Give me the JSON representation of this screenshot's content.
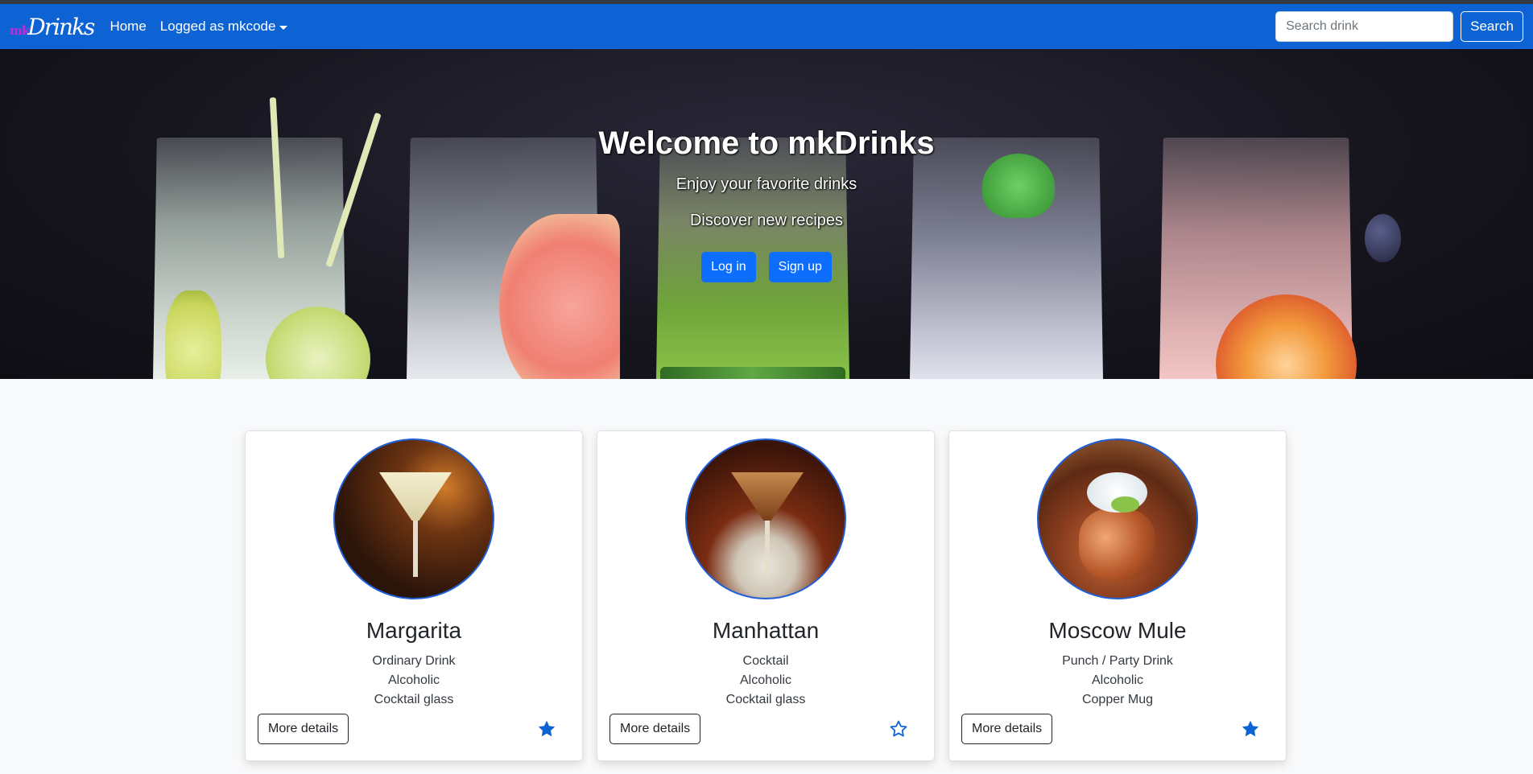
{
  "navbar": {
    "brand_prefix": "mk",
    "brand_suffix": "Drinks",
    "home_label": "Home",
    "user_menu_label": "Logged as mkcode",
    "search_placeholder": "Search drink",
    "search_value": "",
    "search_button_label": "Search"
  },
  "hero": {
    "title": "Welcome to mkDrinks",
    "subtitle_1": "Enjoy your favorite drinks",
    "subtitle_2": "Discover new recipes",
    "login_label": "Log in",
    "signup_label": "Sign up"
  },
  "cards": [
    {
      "name": "Margarita",
      "category": "Ordinary Drink",
      "alcoholic": "Alcoholic",
      "glass": "Cocktail glass",
      "details_label": "More details",
      "favorite": true
    },
    {
      "name": "Manhattan",
      "category": "Cocktail",
      "alcoholic": "Alcoholic",
      "glass": "Cocktail glass",
      "details_label": "More details",
      "favorite": false
    },
    {
      "name": "Moscow Mule",
      "category": "Punch / Party Drink",
      "alcoholic": "Alcoholic",
      "glass": "Copper Mug",
      "details_label": "More details",
      "favorite": true
    }
  ],
  "colors": {
    "navbar": "#0d63d3",
    "primary": "#0d6efd",
    "star": "#0d63d3",
    "brand_prefix": "#c42bd8"
  }
}
